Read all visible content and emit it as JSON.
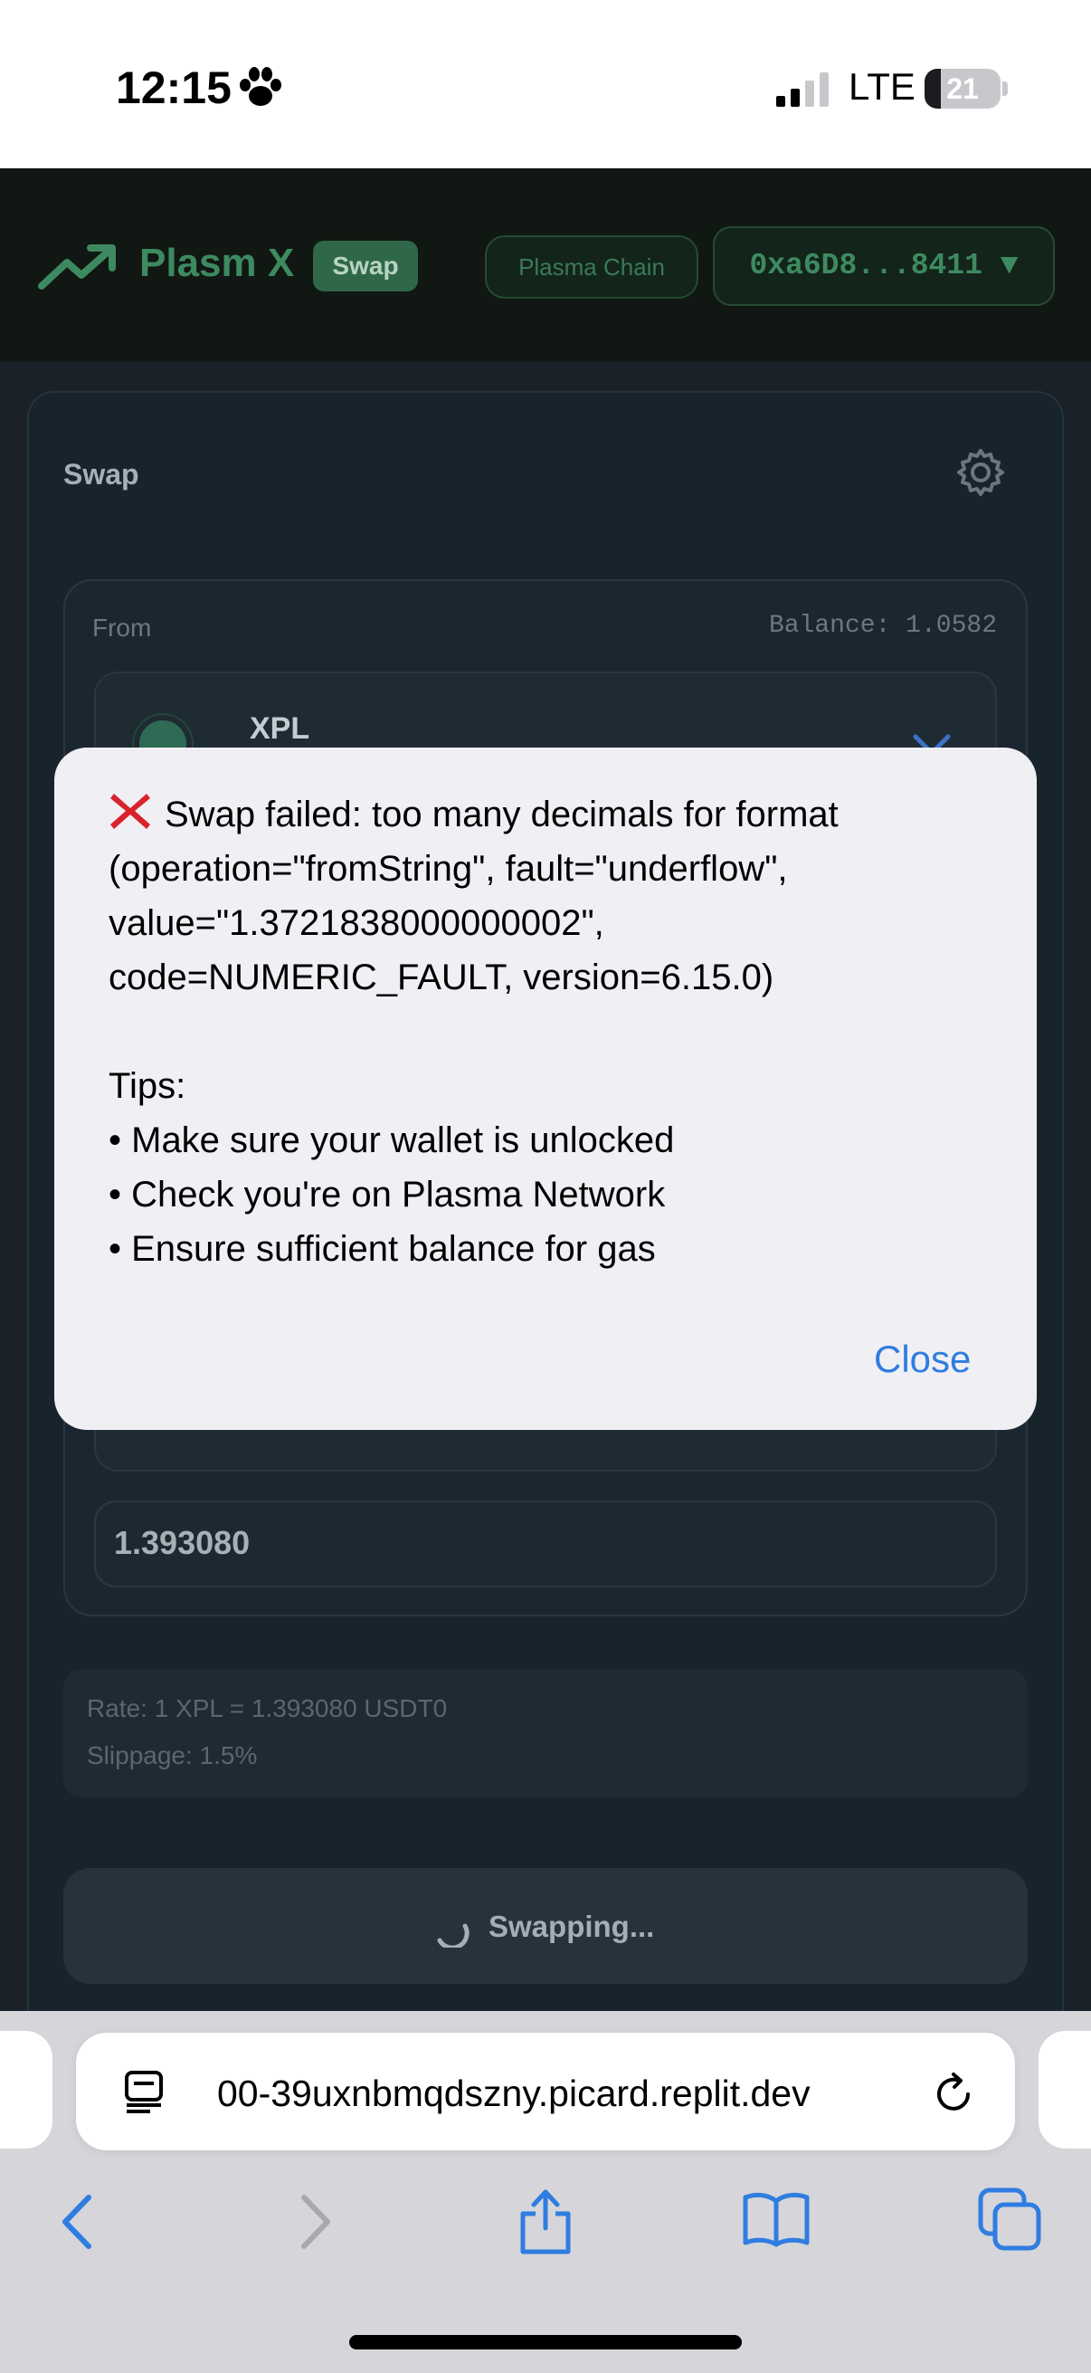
{
  "status_bar": {
    "time": "12:15",
    "network": "LTE",
    "battery": "21",
    "battery_level": 0.21
  },
  "app_header": {
    "brand": "Plasm X",
    "badge": "Swap",
    "chain": "Plasma Chain",
    "wallet": "0xa6D8...8411 ▼"
  },
  "swap_card": {
    "title": "Swap",
    "from_label": "From",
    "balance": "Balance: 1.0582",
    "from_token": "XPL",
    "output_value": "1.393080",
    "rate": "Rate: 1 XPL = 1.393080 USDT0",
    "slippage": "Slippage: 1.5%",
    "button_label": "Swapping..."
  },
  "alert": {
    "message": "Swap failed: too many decimals for format (operation=\"fromString\", fault=\"underflow\", value=\"1.3721838000000002\", code=NUMERIC_FAULT, version=6.15.0)",
    "tips_heading": "Tips:",
    "tips": [
      "• Make sure your wallet is unlocked",
      "• Check you're on Plasma Network",
      "• Ensure sufficient balance for gas"
    ],
    "close_label": "Close"
  },
  "browser": {
    "url": "00-39uxnbmqdszny.picard.replit.dev"
  },
  "colors": {
    "brand_green": "#3d8a60",
    "page_bg": "#1a2129",
    "alert_bg": "#f0eff4",
    "link_blue": "#2f7de1",
    "error_red": "#d8232a"
  },
  "icons": [
    "paw-icon",
    "signal-icon",
    "battery-icon",
    "trending-up-icon",
    "gear-icon",
    "chevron-down-icon",
    "spinner-icon",
    "error-x-icon",
    "reader-icon",
    "reload-icon",
    "back-icon",
    "forward-icon",
    "share-icon",
    "bookmarks-icon",
    "tabs-icon"
  ]
}
